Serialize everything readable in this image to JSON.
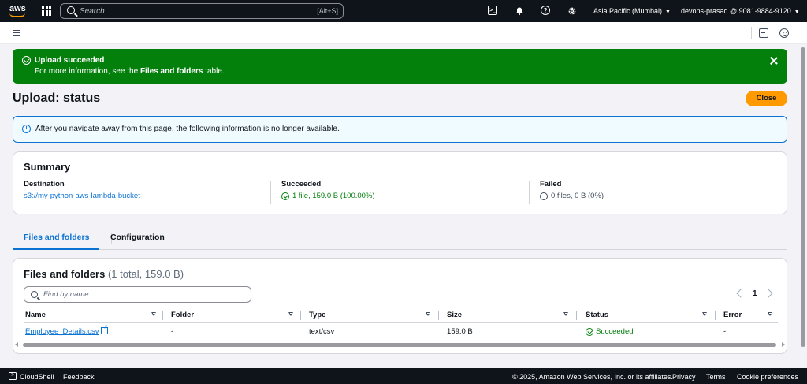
{
  "topnav": {
    "logo_text": "aws",
    "search_placeholder": "Search",
    "search_shortcut": "[Alt+S]",
    "region": "Asia Pacific (Mumbai)",
    "account": "devops-prasad @ 9081-9884-9120"
  },
  "flash": {
    "title": "Upload succeeded",
    "desc_prefix": "For more information, see the ",
    "desc_link": "Files and folders",
    "desc_suffix": " table.",
    "color": "#037f0c"
  },
  "header": {
    "title": "Upload: status",
    "close_label": "Close"
  },
  "info_alert": {
    "text": "After you navigate away from this page, the following information is no longer available."
  },
  "summary": {
    "title": "Summary",
    "destination_label": "Destination",
    "destination_value": "s3://my-python-aws-lambda-bucket",
    "succeeded_label": "Succeeded",
    "succeeded_value": "1 file, 159.0 B (100.00%)",
    "failed_label": "Failed",
    "failed_value": "0 files, 0 B (0%)"
  },
  "tabs": [
    {
      "label": "Files and folders",
      "active": true
    },
    {
      "label": "Configuration",
      "active": false
    }
  ],
  "files": {
    "title": "Files and folders",
    "count": "(1 total, 159.0 B)",
    "search_placeholder": "Find by name",
    "page": "1",
    "columns": [
      "Name",
      "Folder",
      "Type",
      "Size",
      "Status",
      "Error"
    ],
    "rows": [
      {
        "name": "Employee_Details.csv",
        "folder": "-",
        "type": "text/csv",
        "size": "159.0 B",
        "status": "Succeeded",
        "error": "-"
      }
    ]
  },
  "footer": {
    "cloudshell": "CloudShell",
    "feedback": "Feedback",
    "copyright": "© 2025, Amazon Web Services, Inc. or its affiliates.",
    "privacy": "Privacy",
    "terms": "Terms",
    "cookies": "Cookie preferences"
  }
}
